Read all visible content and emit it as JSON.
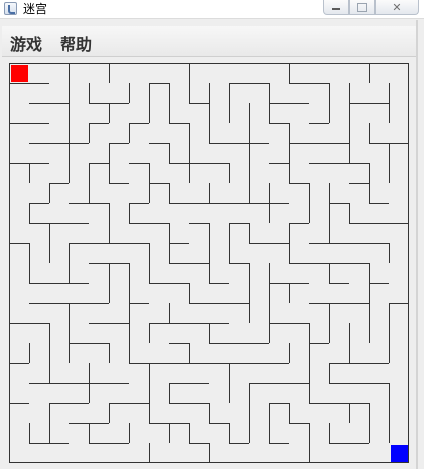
{
  "window": {
    "title": "迷宫"
  },
  "menubar": {
    "items": [
      "游戏",
      "帮助"
    ]
  },
  "maze": {
    "rows": 20,
    "cols": 20,
    "start_cell": [
      0,
      0
    ],
    "goal_cell": [
      19,
      19
    ],
    "colors": {
      "background": "#eeeeee",
      "wall": "#333333",
      "start": "#ff0000",
      "goal": "#0000ff"
    }
  }
}
